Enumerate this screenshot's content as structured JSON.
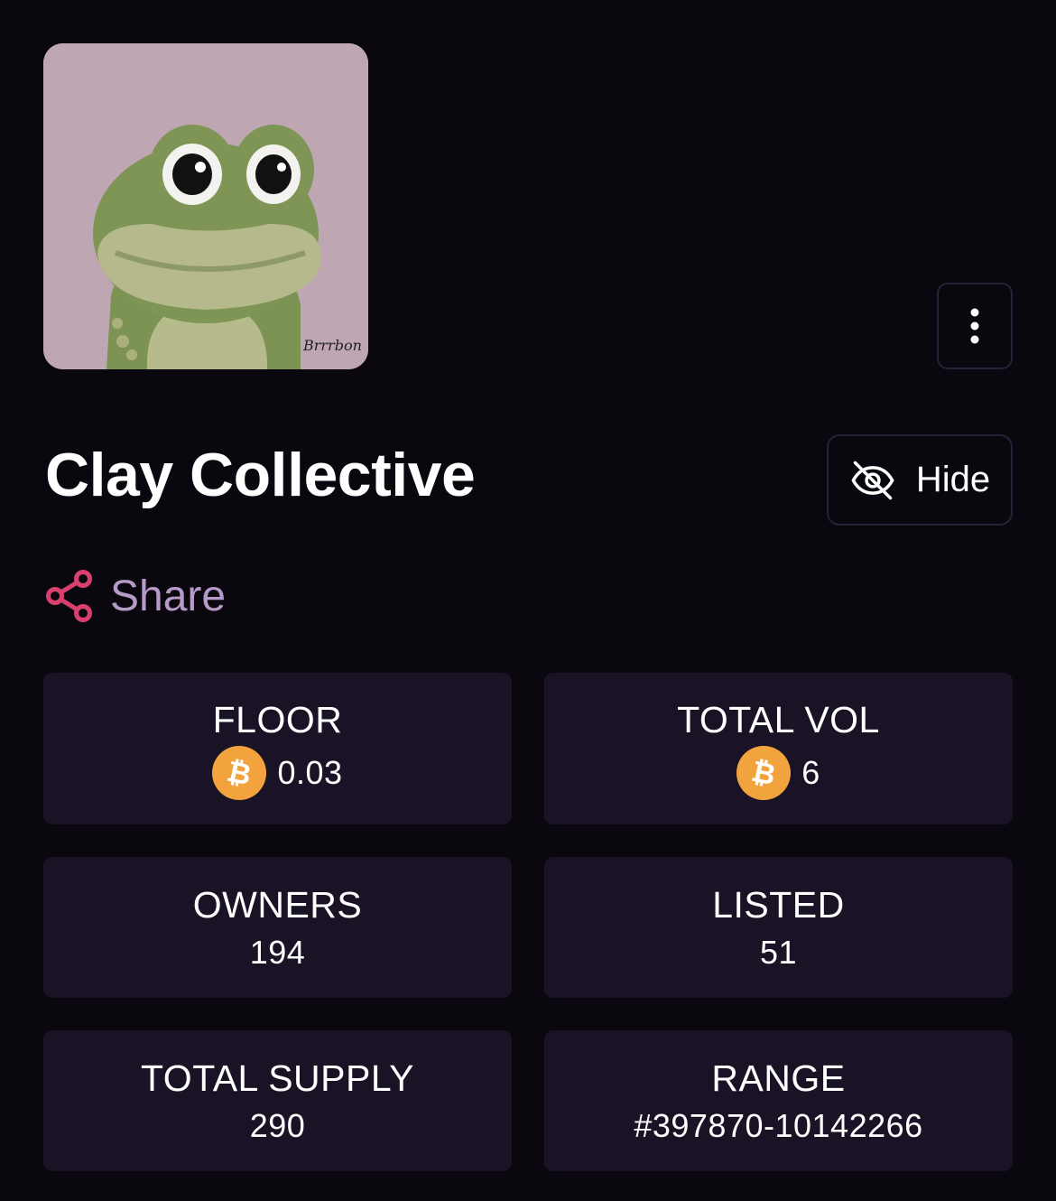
{
  "collection": {
    "title": "Clay Collective",
    "signature": "Brrrbon"
  },
  "actions": {
    "hide_label": "Hide",
    "share_label": "Share"
  },
  "icons": {
    "more": "vertical-ellipsis-icon",
    "hide": "eye-slash-icon",
    "share": "share-nodes-icon",
    "currency": "bitcoin-icon"
  },
  "colors": {
    "background": "#0a070e",
    "card": "#1a1326",
    "share_icon": "#d9406f",
    "share_text": "#b69ac8",
    "bitcoin": "#f2a33e"
  },
  "stats": {
    "floor": {
      "label": "FLOOR",
      "value": "0.03"
    },
    "total_vol": {
      "label": "TOTAL VOL",
      "value": "6"
    },
    "owners": {
      "label": "OWNERS",
      "value": "194"
    },
    "listed": {
      "label": "LISTED",
      "value": "51"
    },
    "total_supply": {
      "label": "TOTAL SUPPLY",
      "value": "290"
    },
    "range": {
      "label": "RANGE",
      "value": "#397870-10142266"
    }
  }
}
